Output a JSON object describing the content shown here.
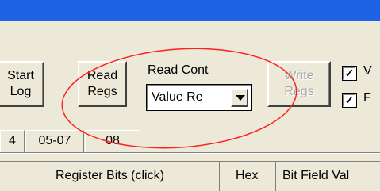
{
  "toolbar": {
    "start_log_label_1": "Start",
    "start_log_label_2": "Log",
    "read_regs_label_1": "Read",
    "read_regs_label_2": "Regs",
    "read_cont_label": "Read Cont",
    "read_cont_value": "Value Re",
    "write_regs_label_1": "Write",
    "write_regs_label_2": "Regs",
    "checkbox_1_label": "V",
    "checkbox_2_label": "F"
  },
  "tabs": [
    "4",
    "05-07",
    "08"
  ],
  "grid_header": {
    "col_blank": "",
    "register_bits": "Register Bits (click)",
    "hex": "Hex",
    "bit_field": "Bit Field Val"
  },
  "annotation": {
    "color": "#ff2020"
  },
  "colors": {
    "title_bar": "#1e62e6",
    "window_bg": "#ece9d8"
  }
}
